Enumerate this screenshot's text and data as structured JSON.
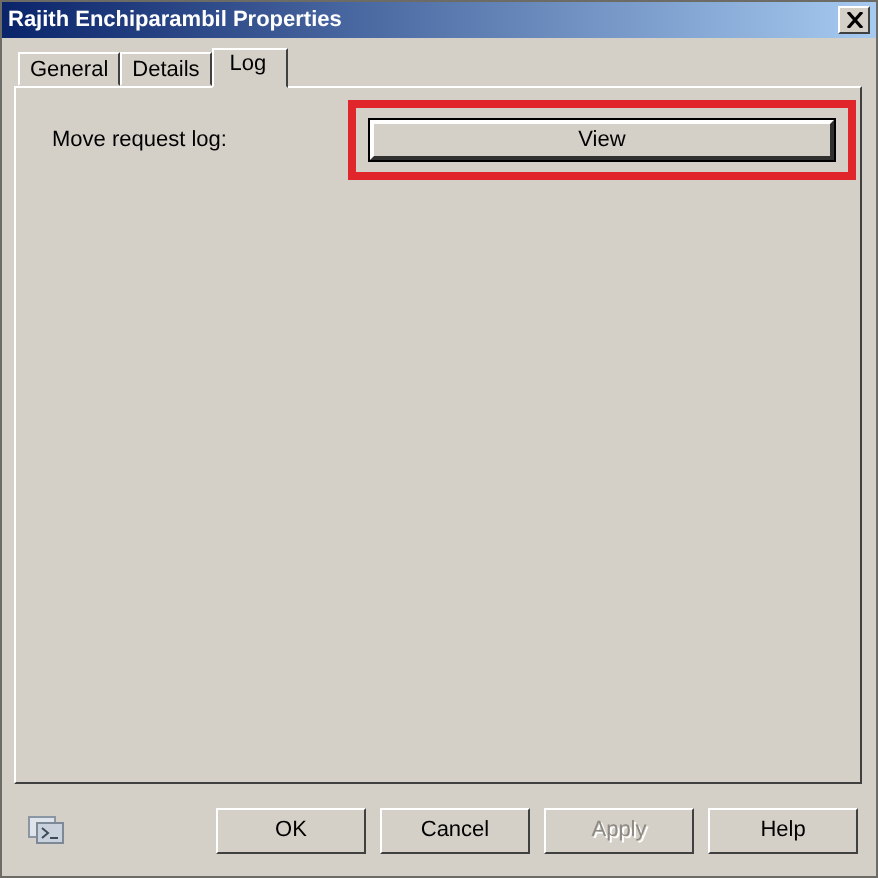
{
  "window": {
    "title": "Rajith Enchiparambil Properties"
  },
  "tabs": [
    {
      "label": "General",
      "selected": false
    },
    {
      "label": "Details",
      "selected": false
    },
    {
      "label": "Log",
      "selected": true
    }
  ],
  "log": {
    "label": "Move request log:",
    "button": {
      "label": "View",
      "highlighted": true
    }
  },
  "buttons": [
    {
      "label": "OK",
      "disabled": false
    },
    {
      "label": "Cancel",
      "disabled": false
    },
    {
      "label": "Apply",
      "disabled": true
    },
    {
      "label": "Help",
      "disabled": false
    }
  ]
}
